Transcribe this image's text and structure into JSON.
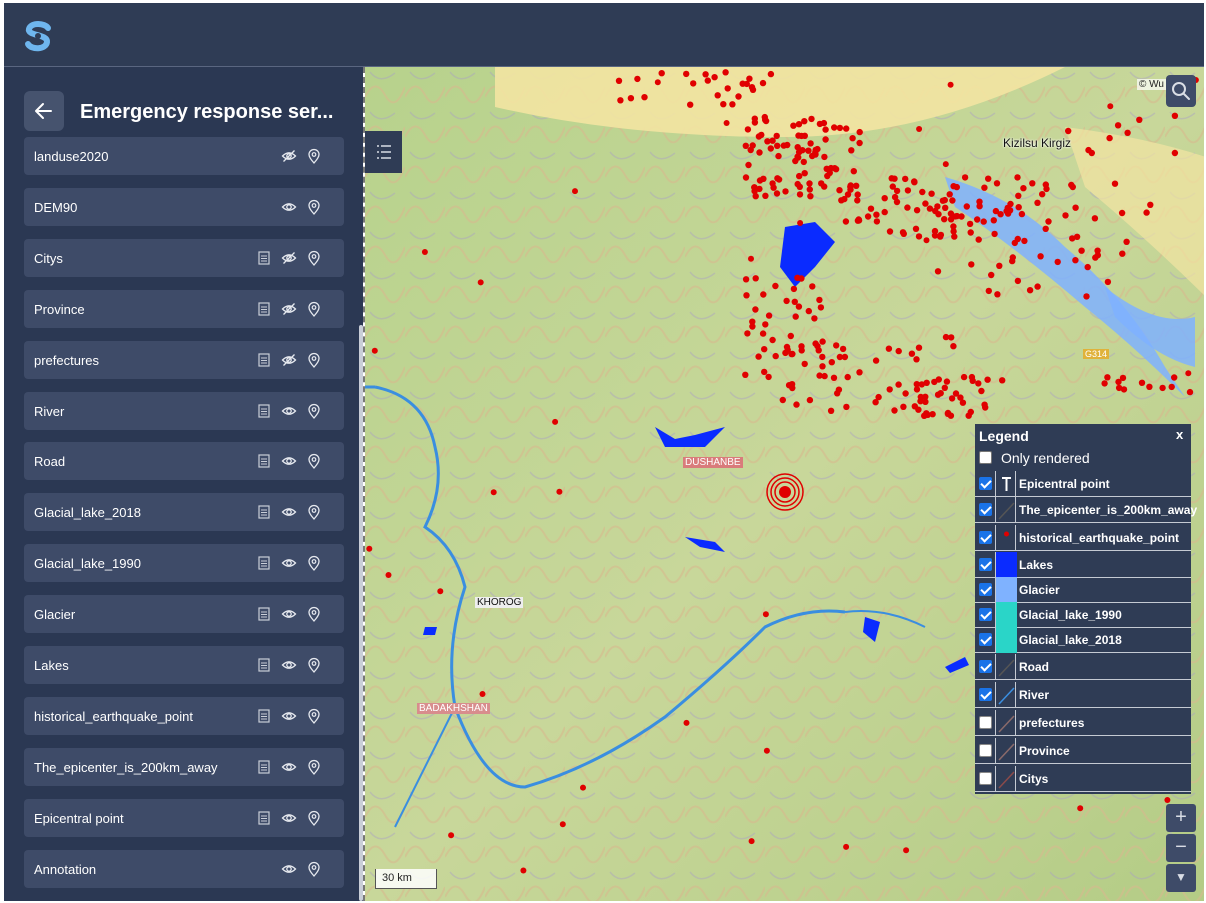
{
  "app": {
    "logo_icon": "logo-s-icon"
  },
  "sidebar": {
    "title": "Emergency response ser...",
    "back_icon": "arrow-left-icon",
    "layers": [
      {
        "name": "landuse2020",
        "table": false,
        "visible": false
      },
      {
        "name": "DEM90",
        "table": false,
        "visible": true
      },
      {
        "name": "Citys",
        "table": true,
        "visible": false
      },
      {
        "name": "Province",
        "table": true,
        "visible": false
      },
      {
        "name": "prefectures",
        "table": true,
        "visible": false
      },
      {
        "name": "River",
        "table": true,
        "visible": true
      },
      {
        "name": "Road",
        "table": true,
        "visible": true
      },
      {
        "name": "Glacial_lake_2018",
        "table": true,
        "visible": true
      },
      {
        "name": "Glacial_lake_1990",
        "table": true,
        "visible": true
      },
      {
        "name": "Glacier",
        "table": true,
        "visible": true
      },
      {
        "name": "Lakes",
        "table": true,
        "visible": true
      },
      {
        "name": "historical_earthquake_point",
        "table": true,
        "visible": true
      },
      {
        "name": "The_epicenter_is_200km_away",
        "table": true,
        "visible": true
      },
      {
        "name": "Epicentral point",
        "table": true,
        "visible": true
      },
      {
        "name": "Annotation",
        "table": false,
        "visible": true
      }
    ]
  },
  "map": {
    "attribution": "© Wu",
    "labels": {
      "kizilsu": "Kizilsu Kirgiz",
      "dushanbe": "DUSHANBE",
      "khorog": "KHOROG",
      "badakhshan": "BADAKHSHAN",
      "g314": "G314"
    },
    "scale": "30 km",
    "zoom_in": "+",
    "zoom_out": "−",
    "colors": {
      "earthquake_point": "#e00000",
      "lake": "#0033ff",
      "glacier": "#7fb2ff",
      "glacial_lake": "#2ad5c8",
      "river": "#3a8ee0"
    }
  },
  "legend": {
    "title": "Legend",
    "close": "x",
    "only_rendered": "Only rendered",
    "items": [
      {
        "label": "Epicentral point",
        "checked": true,
        "symbol": "text-T"
      },
      {
        "label": "The_epicenter_is_200km_away",
        "checked": true,
        "symbol": "line",
        "color": "#555555"
      },
      {
        "label": "historical_earthquake_point",
        "checked": true,
        "symbol": "dot",
        "color": "#e00000"
      },
      {
        "label": "Lakes",
        "checked": true,
        "symbol": "fill",
        "color": "#0a2bff"
      },
      {
        "label": "Glacier",
        "checked": true,
        "symbol": "fill",
        "color": "#7fb2ff"
      },
      {
        "label": "Glacial_lake_1990",
        "checked": true,
        "symbol": "fill",
        "color": "#2ad5c8"
      },
      {
        "label": "Glacial_lake_2018",
        "checked": true,
        "symbol": "fill",
        "color": "#2ad5c8"
      },
      {
        "label": "Road",
        "checked": true,
        "symbol": "line",
        "color": "#555555"
      },
      {
        "label": "River",
        "checked": true,
        "symbol": "line",
        "color": "#3a8ee0"
      },
      {
        "label": "prefectures",
        "checked": false,
        "symbol": "line",
        "color": "#8a6a6a"
      },
      {
        "label": "Province",
        "checked": false,
        "symbol": "line",
        "color": "#8a6a6a"
      },
      {
        "label": "Citys",
        "checked": false,
        "symbol": "line",
        "color": "#8a4a4a"
      }
    ]
  }
}
